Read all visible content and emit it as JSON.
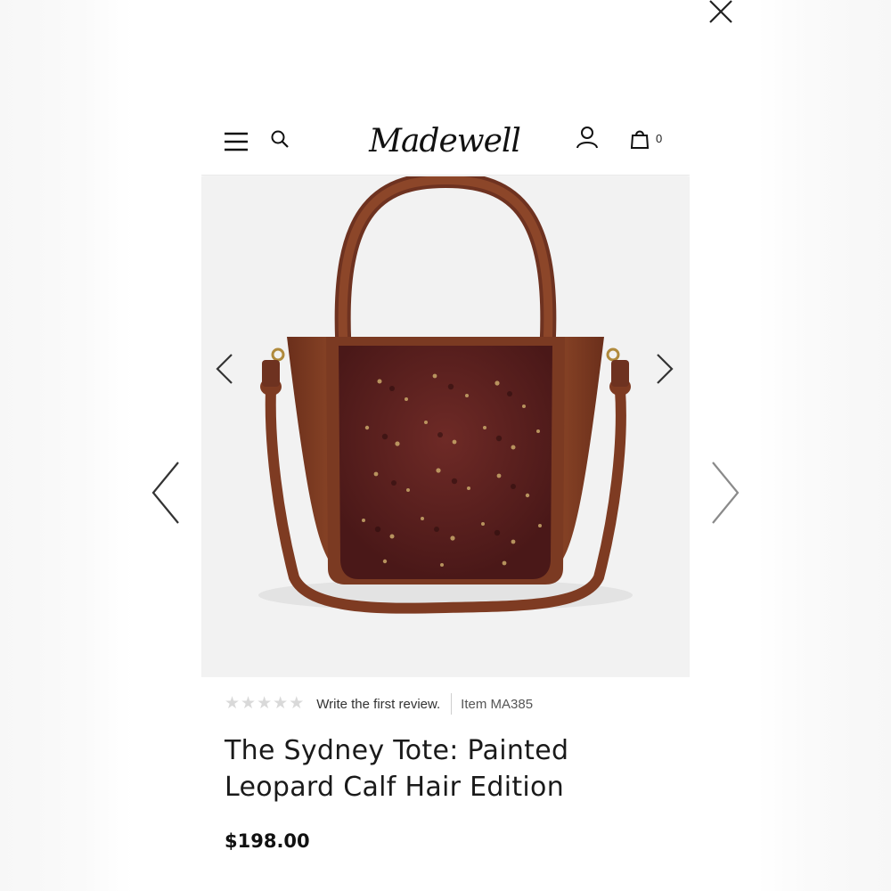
{
  "header": {
    "logo_text": "Madewell",
    "cart_count": "0",
    "icons": [
      "hamburger-menu-icon",
      "search-icon",
      "account-icon",
      "shopping-bag-icon"
    ]
  },
  "lightbox": {
    "icons": [
      "close-icon",
      "chevron-left-icon",
      "chevron-right-icon"
    ]
  },
  "product": {
    "rating": 0,
    "review_link": "Write the first review.",
    "item_number": "Item MA385",
    "title_line1": "The Sydney Tote: Painted",
    "title_line2": "Leopard Calf Hair Edition",
    "price": "$198.00"
  },
  "colors": {
    "leather_brown": "#7a3a22",
    "calf_hair": "#5a1f1f",
    "image_background": "#f2f2f2",
    "text_primary": "#1a1a1a"
  }
}
